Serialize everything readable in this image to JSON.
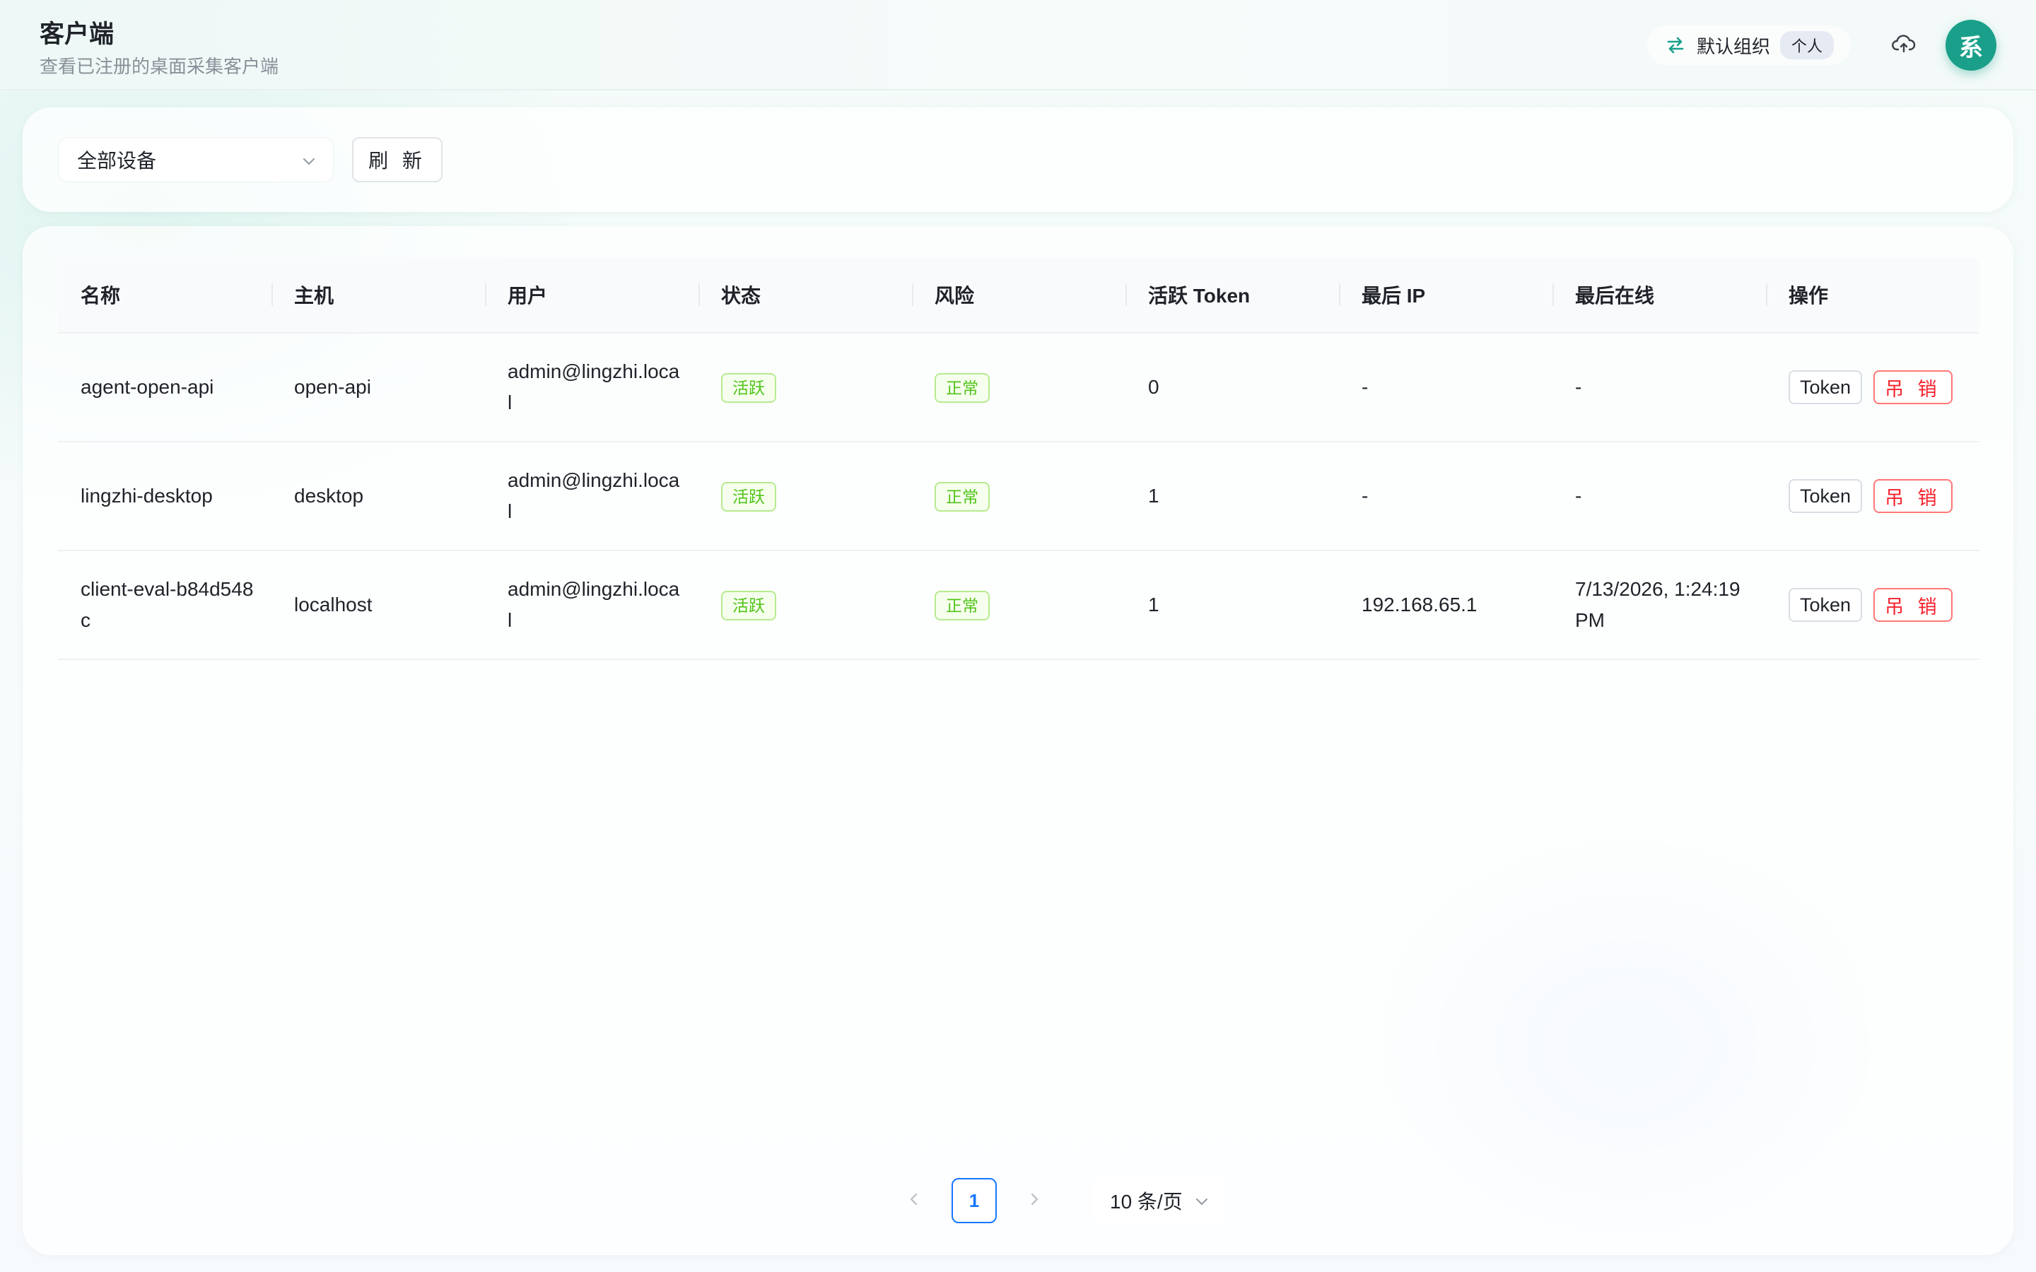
{
  "header": {
    "title": "客户端",
    "subtitle": "查看已注册的桌面采集客户端",
    "org_name": "默认组织",
    "org_badge": "个人",
    "avatar_text": "系",
    "icons": [
      "swap-icon",
      "cloud-upload-icon"
    ]
  },
  "filter": {
    "device_select_value": "全部设备",
    "refresh_label": "刷 新"
  },
  "table": {
    "columns": [
      "名称",
      "主机",
      "用户",
      "状态",
      "风险",
      "活跃 Token",
      "最后 IP",
      "最后在线",
      "操作"
    ],
    "rows": [
      {
        "name": "agent-open-api",
        "host": "open-api",
        "user": "admin@lingzhi.local",
        "status": "活跃",
        "risk": "正常",
        "active_tokens": "0",
        "last_ip": "-",
        "last_online": "-",
        "token_label": "Token",
        "revoke_label": "吊 销"
      },
      {
        "name": "lingzhi-desktop",
        "host": "desktop",
        "user": "admin@lingzhi.local",
        "status": "活跃",
        "risk": "正常",
        "active_tokens": "1",
        "last_ip": "-",
        "last_online": "-",
        "token_label": "Token",
        "revoke_label": "吊 销"
      },
      {
        "name": "client-eval-b84d548c",
        "host": "localhost",
        "user": "admin@lingzhi.local",
        "status": "活跃",
        "risk": "正常",
        "active_tokens": "1",
        "last_ip": "192.168.65.1",
        "last_online": "7/13/2026, 1:24:19 PM",
        "token_label": "Token",
        "revoke_label": "吊 销"
      }
    ]
  },
  "pagination": {
    "current_page": "1",
    "page_size": "10 条/页"
  },
  "colors": {
    "accent": "#1aa08a",
    "primary": "#1677ff",
    "success": "#52c41a",
    "danger": "#f5222d"
  }
}
